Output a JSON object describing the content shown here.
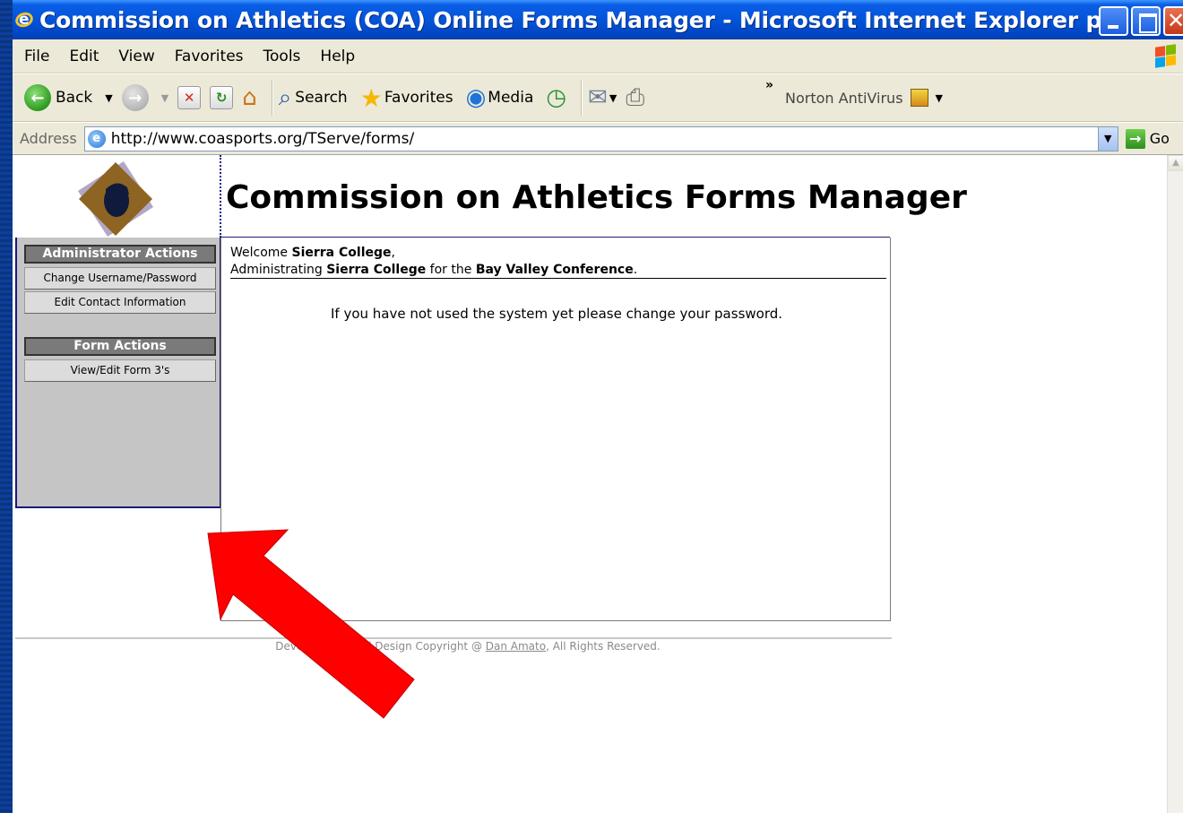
{
  "window": {
    "title": "Commission on Athletics (COA) Online Forms Manager - Microsoft Internet Explorer provided b..."
  },
  "menubar": {
    "items": [
      "File",
      "Edit",
      "View",
      "Favorites",
      "Tools",
      "Help"
    ]
  },
  "toolbar": {
    "back_label": "Back",
    "search_label": "Search",
    "favorites_label": "Favorites",
    "media_label": "Media",
    "overflow_label": "»",
    "norton_label": "Norton AntiVirus"
  },
  "address": {
    "label": "Address",
    "url": "http://www.coasports.org/TServe/forms/",
    "go_label": "Go"
  },
  "page": {
    "heading": "Commission on Athletics Forms Manager",
    "sidebar": {
      "admin_title": "Administrator Actions",
      "admin_links": [
        "Change Username/Password",
        "Edit Contact Information"
      ],
      "form_title": "Form Actions",
      "form_links": [
        "View/Edit Form 3's"
      ]
    },
    "welcome": {
      "line1_prefix": "Welcome ",
      "user": "Sierra College",
      "line1_suffix": ",",
      "line2_prefix": "Administrating ",
      "college": "Sierra College",
      "line2_mid": " for the ",
      "conference": "Bay Valley Conference",
      "line2_suffix": "."
    },
    "notice": "If you have not used the system yet please change your password.",
    "footer": {
      "prefix": "Development and Design Copyright @ ",
      "author": "Dan Amato",
      "suffix": ", All Rights Reserved."
    }
  },
  "colors": {
    "annotation_arrow": "#ff0000",
    "sidebar_bg": "#c5c5c5",
    "titlebar": "#0354d8"
  }
}
